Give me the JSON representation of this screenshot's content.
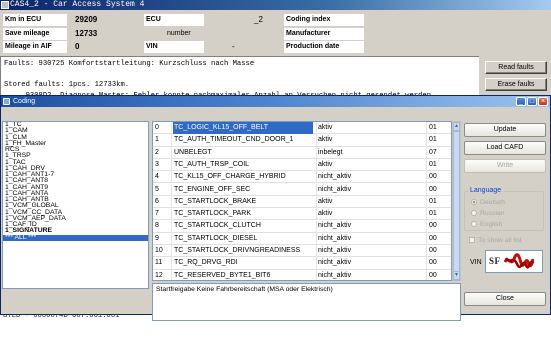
{
  "main": {
    "title": "CAS4_2 - Car Access System 4",
    "ecu_info": {
      "km_label": "Km in ECU",
      "km_value": "29209",
      "save_mileage_label": "Save mileage",
      "save_mileage_value": "12733",
      "aif_label": "Mileage in AIF",
      "aif_value": "0",
      "ecu_label": "ECU",
      "ecu_value": "_2",
      "number_label": "number",
      "vin_label": "VIN",
      "vin_value": "-",
      "coding_index_label": "Coding index",
      "manufacturer_label": "Manufacturer",
      "production_date_label": "Production date"
    },
    "faults_text": "Faults: 930725 Komfortstartleitung: Kurzschluss nach Masse\n\nStored faults: 1pcs. 12733km.\n     9308D2  Diagnose Master: Fehler konnte nachmaximaler Anzahl an Versuchen nicht gesendet werden.",
    "read_faults_label": "Read faults",
    "erase_faults_label": "Erase faults",
    "bottom_lines": "HWAP - 000002EA-255.255.255\nBTLD - 0000074B-007.001.001"
  },
  "dialog": {
    "title": "Coding",
    "left_items": [
      {
        "label": "1_TC"
      },
      {
        "label": "1_CAM"
      },
      {
        "label": "1_CLM"
      },
      {
        "label": "1_FH_Master"
      },
      {
        "label": "RCS"
      },
      {
        "label": "1_TRSP"
      },
      {
        "label": "1_TAC"
      },
      {
        "label": "1_CAH_DRV"
      },
      {
        "label": "1_CAH_ANT1-7"
      },
      {
        "label": "1_CAH_ANT8"
      },
      {
        "label": "1_CAH_ANT9"
      },
      {
        "label": "1_CAH_ANTA"
      },
      {
        "label": "1_CAH_ANTB"
      },
      {
        "label": "1_VCM_GLOBAL"
      },
      {
        "label": "1_VCM_CC_DATA"
      },
      {
        "label": "1_VCM_AEP_DATA"
      },
      {
        "label": "1_CAF_ID"
      },
      {
        "label": "1_SIGNATURE"
      },
      {
        "label": "*** ALL ***"
      }
    ],
    "rows": [
      {
        "idx": "0",
        "name": "TC_LOGIC_KL15_OFF_BELT",
        "state": "aktiv",
        "val": "01"
      },
      {
        "idx": "1",
        "name": "TC_AUTH_TIMEOUT_CND_DOOR_1",
        "state": "aktiv",
        "val": "01"
      },
      {
        "idx": "2",
        "name": "UNBELEGT",
        "state": "inbelegt",
        "val": "07"
      },
      {
        "idx": "3",
        "name": "TC_AUTH_TRSP_COIL",
        "state": "aktiv",
        "val": "01"
      },
      {
        "idx": "4",
        "name": "TC_KL15_OFF_CHARGE_HYBRID",
        "state": "nicht_aktiv",
        "val": "00"
      },
      {
        "idx": "5",
        "name": "TC_ENGINE_OFF_SEC",
        "state": "nicht_aktiv",
        "val": "00"
      },
      {
        "idx": "6",
        "name": "TC_STARTLOCK_BRAKE",
        "state": "aktiv",
        "val": "01"
      },
      {
        "idx": "7",
        "name": "TC_STARTLOCK_PARK",
        "state": "aktiv",
        "val": "01"
      },
      {
        "idx": "8",
        "name": "TC_STARTLOCK_CLUTCH",
        "state": "nicht_aktiv",
        "val": "00"
      },
      {
        "idx": "9",
        "name": "TC_STARTLOCK_DIESEL",
        "state": "nicht_aktiv",
        "val": "00"
      },
      {
        "idx": "10",
        "name": "TC_STARTLOCK_DRIVNGREADINESS",
        "state": "nicht_aktiv",
        "val": "00"
      },
      {
        "idx": "11",
        "name": "TC_RQ_DRVG_RDI",
        "state": "nicht_aktiv",
        "val": "00"
      },
      {
        "idx": "12",
        "name": "TC_RESERVED_BYTE1_BIT6",
        "state": "nicht_aktiv",
        "val": "00"
      }
    ],
    "description": "Startfreigabe Keine Fahrbereitschaft (MSA oder Elektrisch)",
    "buttons": {
      "update": "Update",
      "load_cafd": "Load CAFD",
      "write": "Write",
      "close": "Close"
    },
    "language": {
      "title": "Language",
      "options": [
        "Deutsch",
        "Russian",
        "English"
      ],
      "selected": "Deutsch"
    },
    "show_all_label": "To show all list",
    "vin_label": "VIN",
    "vin_value": "SF"
  },
  "colors": {
    "title_bar": "#0a246a",
    "dialog_title": "#1c4ea0",
    "selection": "#3169c6",
    "group_label": "#0046d5",
    "window_bg": "#d4d0c8"
  }
}
